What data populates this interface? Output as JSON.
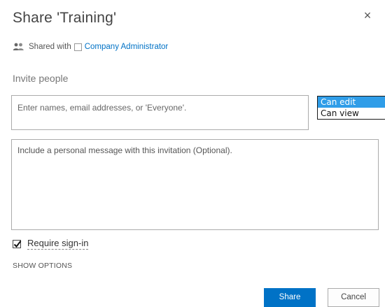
{
  "dialog": {
    "title": "Share 'Training'",
    "close_glyph": "×"
  },
  "shared_with": {
    "icon": "people-icon",
    "label": "Shared with",
    "link_text": "Company Administrator"
  },
  "invite": {
    "label": "Invite people",
    "names_placeholder": "Enter names, email addresses, or 'Everyone'.",
    "permissions": [
      "Can edit",
      "Can view"
    ],
    "selected_permission": "Can edit",
    "message_placeholder": "Include a personal message with this invitation (Optional)."
  },
  "options": {
    "require_signin_label": "Require sign-in",
    "require_signin_checked": true,
    "show_options_label": "SHOW OPTIONS"
  },
  "buttons": {
    "share": "Share",
    "cancel": "Cancel"
  },
  "colors": {
    "accent": "#0072c6",
    "selected_option": "#2f9de8"
  }
}
